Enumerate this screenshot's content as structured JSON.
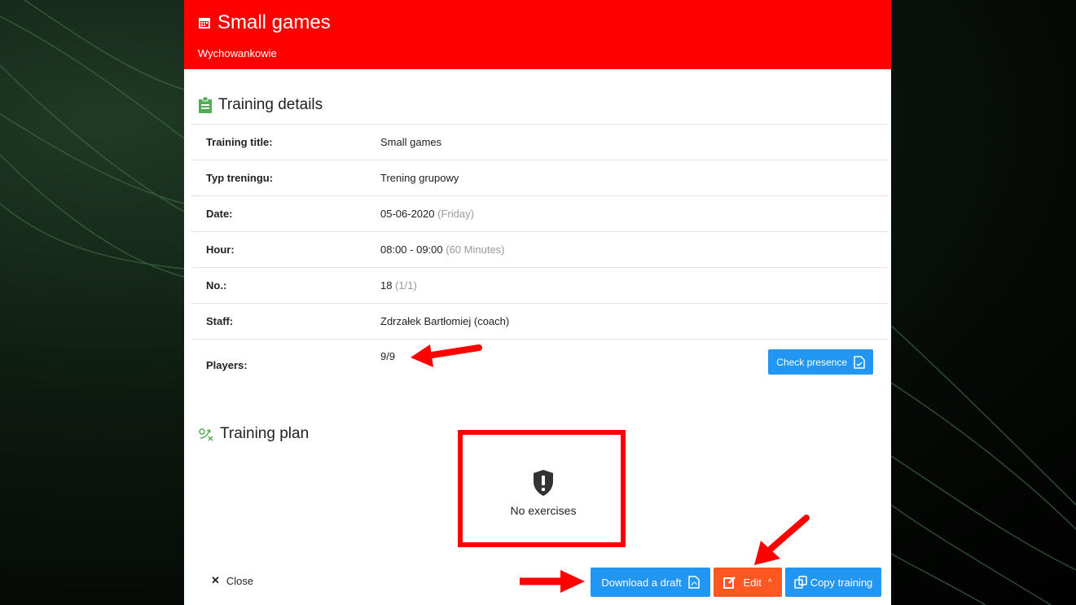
{
  "header": {
    "title": "Small games",
    "subtitle": "Wychowankowie",
    "calendar_icon": "calendar-icon",
    "background_color": "#ff0000"
  },
  "details_section": {
    "title": "Training details",
    "icon": "clipboard-icon",
    "rows": [
      {
        "label": "Training title:",
        "value": "Small games",
        "extra": ""
      },
      {
        "label": "Typ treningu:",
        "value": "Trening grupowy",
        "extra": ""
      },
      {
        "label": "Date:",
        "value": "05-06-2020",
        "extra": "(Friday)"
      },
      {
        "label": "Hour:",
        "value": "08:00 - 09:00",
        "extra": "(60 Minutes)"
      },
      {
        "label": "No.:",
        "value": "18",
        "extra": "(1/1)"
      },
      {
        "label": "Staff:",
        "value": "Zdrzałek Bartłomiej (coach)",
        "extra": ""
      },
      {
        "label": "Players:",
        "value": "9/9",
        "extra": ""
      }
    ],
    "check_presence_label": "Check presence"
  },
  "plan_section": {
    "title": "Training plan",
    "icon": "tactics-icon",
    "empty_message": "No exercises",
    "empty_icon": "shield-exclamation-icon"
  },
  "footer": {
    "close_label": "Close",
    "download_label": "Download a draft",
    "edit_label": "Edit",
    "copy_label": "Copy training"
  },
  "colors": {
    "primary_blue": "#2196f3",
    "accent_orange": "#ff5722",
    "annotation_red": "#ff0000",
    "icon_green": "#4caf50"
  }
}
